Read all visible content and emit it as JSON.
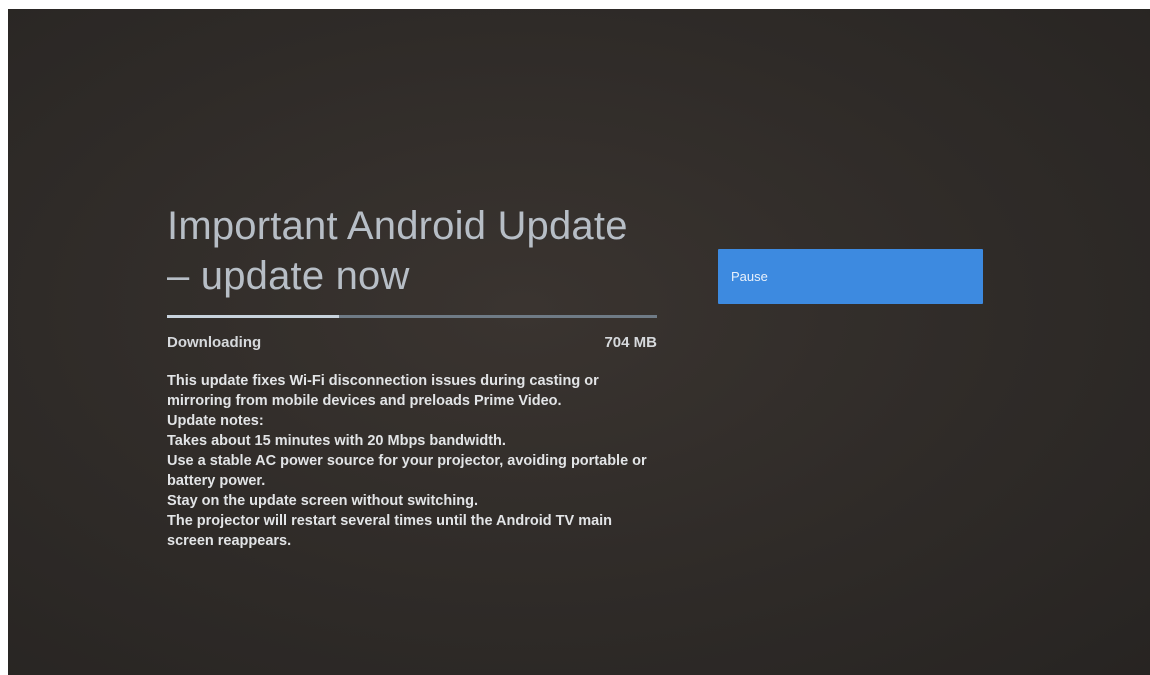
{
  "update": {
    "title_line1": "Important Android Update",
    "title_line2": "– update now",
    "progress_fraction": 0.35,
    "status": "Downloading",
    "size": "704 MB",
    "notes": [
      "This update fixes Wi-Fi disconnection issues during casting or",
      "mirroring from mobile devices and preloads Prime Video.",
      "Update notes:",
      "Takes about 15 minutes with 20 Mbps bandwidth.",
      "Use a stable AC power source for your projector, avoiding portable or",
      "battery power.",
      "Stay on the update screen without switching.",
      "The projector will restart several times until the Android TV main",
      "screen reappears."
    ]
  },
  "actions": {
    "pause_label": "Pause"
  },
  "colors": {
    "accent": "#3d8ae0",
    "background": "#2f2b28",
    "title": "#b7bec6"
  }
}
